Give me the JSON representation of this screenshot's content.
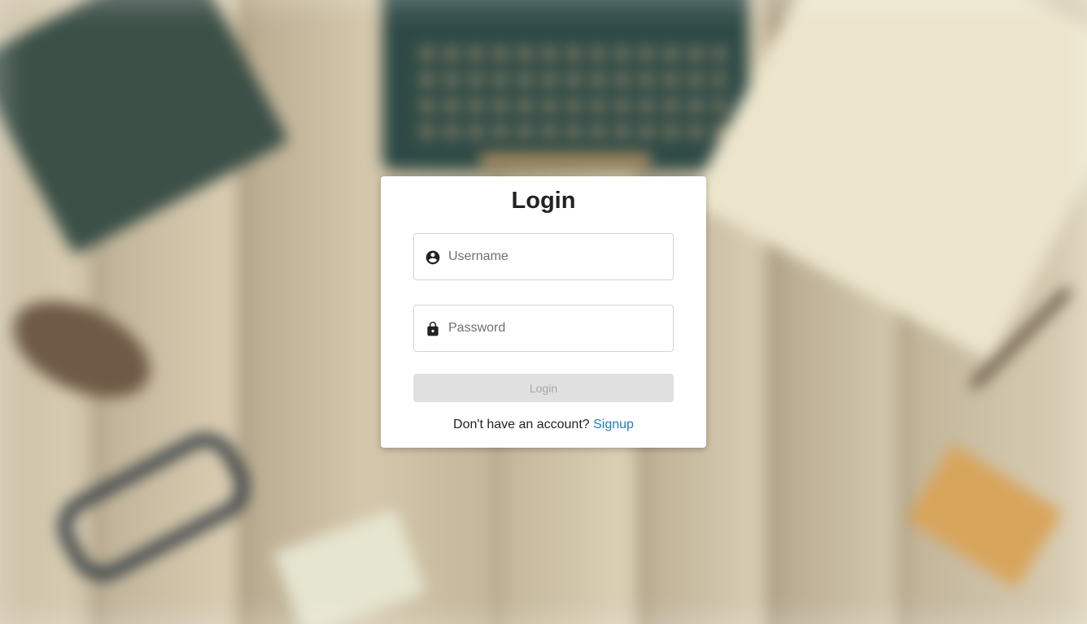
{
  "login": {
    "title": "Login",
    "username": {
      "icon": "account-circle-icon",
      "placeholder": "Username",
      "value": ""
    },
    "password": {
      "icon": "lock-icon",
      "placeholder": "Password",
      "value": ""
    },
    "submit_label": "Login",
    "signup_prompt": "Don't have an account?",
    "signup_link_label": "Signup"
  },
  "colors": {
    "title_text": "#222222",
    "button_disabled_bg": "#e0e0e0",
    "button_disabled_text": "#a6a6a6",
    "link": "#1f7bc1",
    "field_border": "#d4d4d4",
    "card_bg": "#ffffff"
  }
}
